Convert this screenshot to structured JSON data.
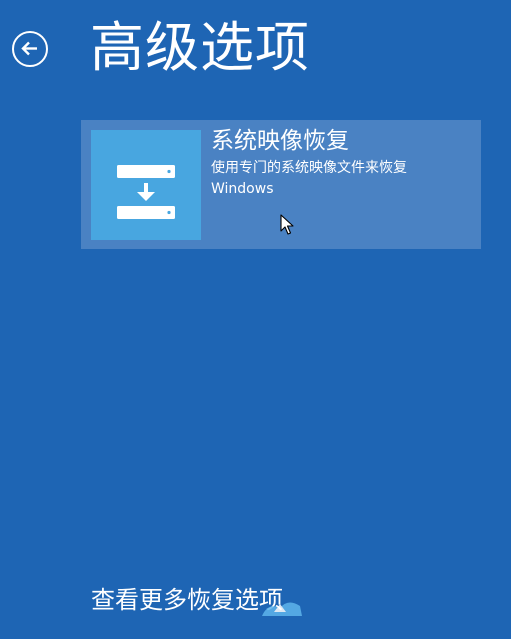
{
  "header": {
    "title": "高级选项",
    "back_icon": "back-arrow-circle-icon"
  },
  "options": [
    {
      "title": "系统映像恢复",
      "description_line1": "使用专门的系统映像文件来恢复",
      "description_line2": "Windows",
      "icon": "system-image-recovery-icon",
      "tile_color": "#4a82c3",
      "icon_bg_color": "#48a6e0"
    }
  ],
  "footer": {
    "more_options": "查看更多恢复选项"
  },
  "colors": {
    "background": "#1e65b4",
    "text": "#ffffff"
  }
}
